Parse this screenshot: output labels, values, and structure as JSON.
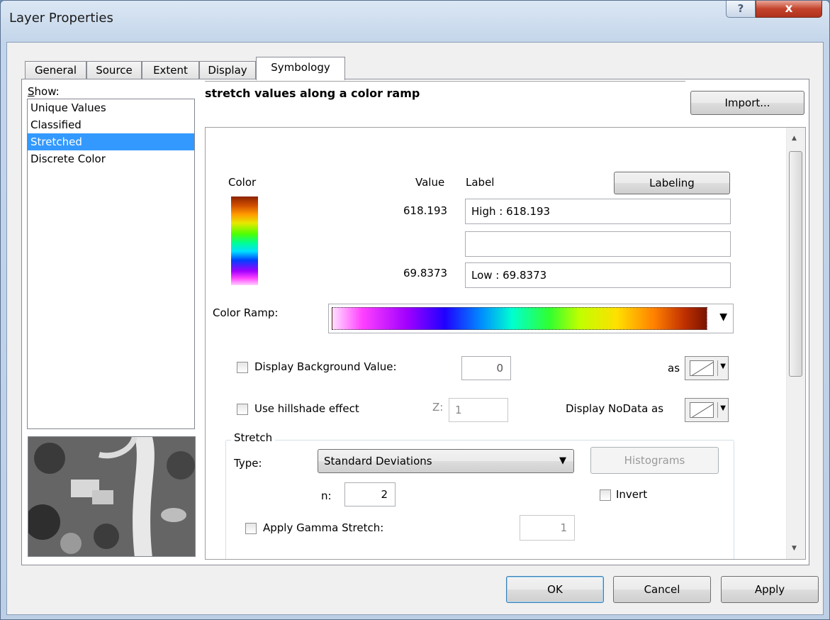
{
  "window": {
    "title": "Layer Properties",
    "help_label": "?",
    "close_label": "x"
  },
  "tabs": [
    {
      "label": "General"
    },
    {
      "label": "Source"
    },
    {
      "label": "Extent"
    },
    {
      "label": "Display"
    },
    {
      "label": "Symbology"
    }
  ],
  "show": {
    "label": "Show:",
    "items": [
      "Unique Values",
      "Classified",
      "Stretched",
      "Discrete Color"
    ],
    "selected": "Stretched"
  },
  "symbology": {
    "heading": "stretch values along a color ramp",
    "import_label": "Import...",
    "color_header": "Color",
    "value_header": "Value",
    "label_header": "Label",
    "labeling_button": "Labeling",
    "high_value": "618.193",
    "high_label": "High : 618.193",
    "mid_label": "",
    "low_value": "69.8373",
    "low_label": "Low : 69.8373",
    "color_ramp_label": "Color Ramp:",
    "display_background_label": "Display Background Value:",
    "background_value": "0",
    "as_label": "as",
    "hillshade_label": "Use hillshade effect",
    "z_label": "Z:",
    "z_value": "1",
    "nodata_label": "Display NoData as",
    "stretch": {
      "group_label": "Stretch",
      "type_label": "Type:",
      "type_value": "Standard Deviations",
      "histograms_label": "Histograms",
      "n_label": "n:",
      "n_value": "2",
      "invert_label": "Invert",
      "gamma_label": "Apply Gamma Stretch:",
      "gamma_value": "1"
    }
  },
  "footer": {
    "ok_label": "OK",
    "cancel_label": "Cancel",
    "apply_label": "Apply"
  }
}
